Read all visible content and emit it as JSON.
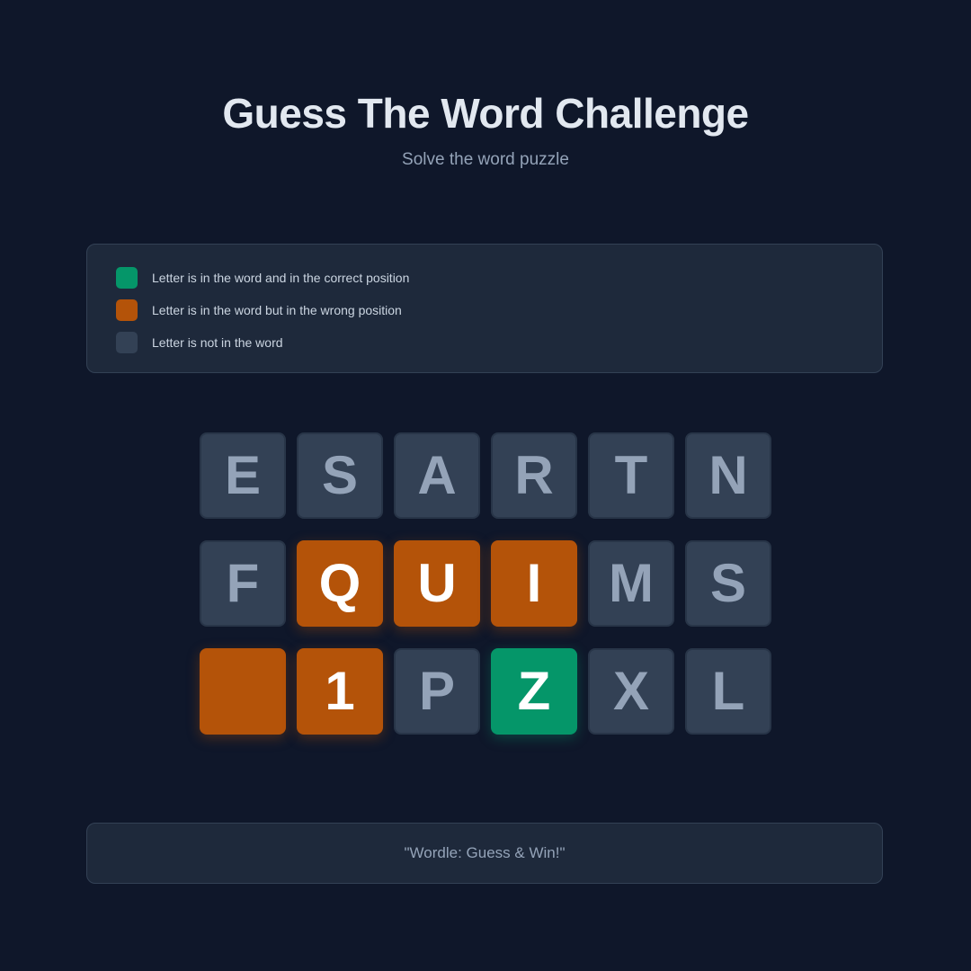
{
  "header": {
    "title": "Guess The Word Challenge",
    "subtitle": "Solve the word puzzle"
  },
  "legend": [
    {
      "state": "correct",
      "color": "#059669",
      "text": "Letter is in the word and in the correct position"
    },
    {
      "state": "present",
      "color": "#b45309",
      "text": "Letter is in the word but in the wrong position"
    },
    {
      "state": "absent",
      "color": "#334155",
      "text": "Letter is not in the word"
    }
  ],
  "board": [
    [
      {
        "letter": "E",
        "state": "absent"
      },
      {
        "letter": "S",
        "state": "absent"
      },
      {
        "letter": "A",
        "state": "absent"
      },
      {
        "letter": "R",
        "state": "absent"
      },
      {
        "letter": "T",
        "state": "absent"
      },
      {
        "letter": "N",
        "state": "absent"
      }
    ],
    [
      {
        "letter": "F",
        "state": "absent"
      },
      {
        "letter": "Q",
        "state": "present"
      },
      {
        "letter": "U",
        "state": "present"
      },
      {
        "letter": "I",
        "state": "present"
      },
      {
        "letter": "M",
        "state": "absent"
      },
      {
        "letter": "S",
        "state": "absent"
      }
    ],
    [
      {
        "letter": "",
        "state": "present"
      },
      {
        "letter": "1",
        "state": "present"
      },
      {
        "letter": "P",
        "state": "absent"
      },
      {
        "letter": "Z",
        "state": "correct"
      },
      {
        "letter": "X",
        "state": "absent"
      },
      {
        "letter": "L",
        "state": "absent"
      }
    ]
  ],
  "footer": {
    "text": "\"Wordle: Guess & Win!\""
  }
}
